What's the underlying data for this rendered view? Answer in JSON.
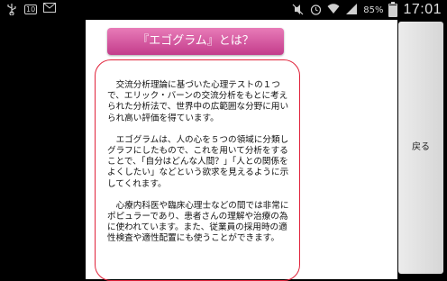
{
  "status_bar": {
    "left_icons": [
      "usb-icon",
      "notification-icon",
      "gmail-icon"
    ],
    "sim_badge": "10",
    "battery_percent": "85%",
    "battery_level": 0.85,
    "time": "17:01"
  },
  "panel": {
    "title": "『エゴグラム』とは？",
    "paragraphs": [
      "交流分析理論に基づいた心理テストの１つで、エリック・バーンの交流分析をもとに考えられた分析法で、世界中の広範囲な分野に用いられ高い評価を得ています。",
      "エゴグラムは、人の心を５つの領域に分類しグラフにしたもので、これを用いて分析をすることで、「自分はどんな人間？」「人との関係をよくしたい」などという欲求を見えるように示してくれます。",
      "心療内科医や臨床心理士などの間では非常にポピュラーであり、患者さんの理解や治療の為に使われています。また、従業員の採用時の適性検査や適性配置にも使うことができます。"
    ]
  },
  "back_button": {
    "label": "戻る"
  },
  "colors": {
    "title_gradient_top": "#e87bb8",
    "title_gradient_bottom": "#c33c8b",
    "border_red": "#e0223a"
  }
}
